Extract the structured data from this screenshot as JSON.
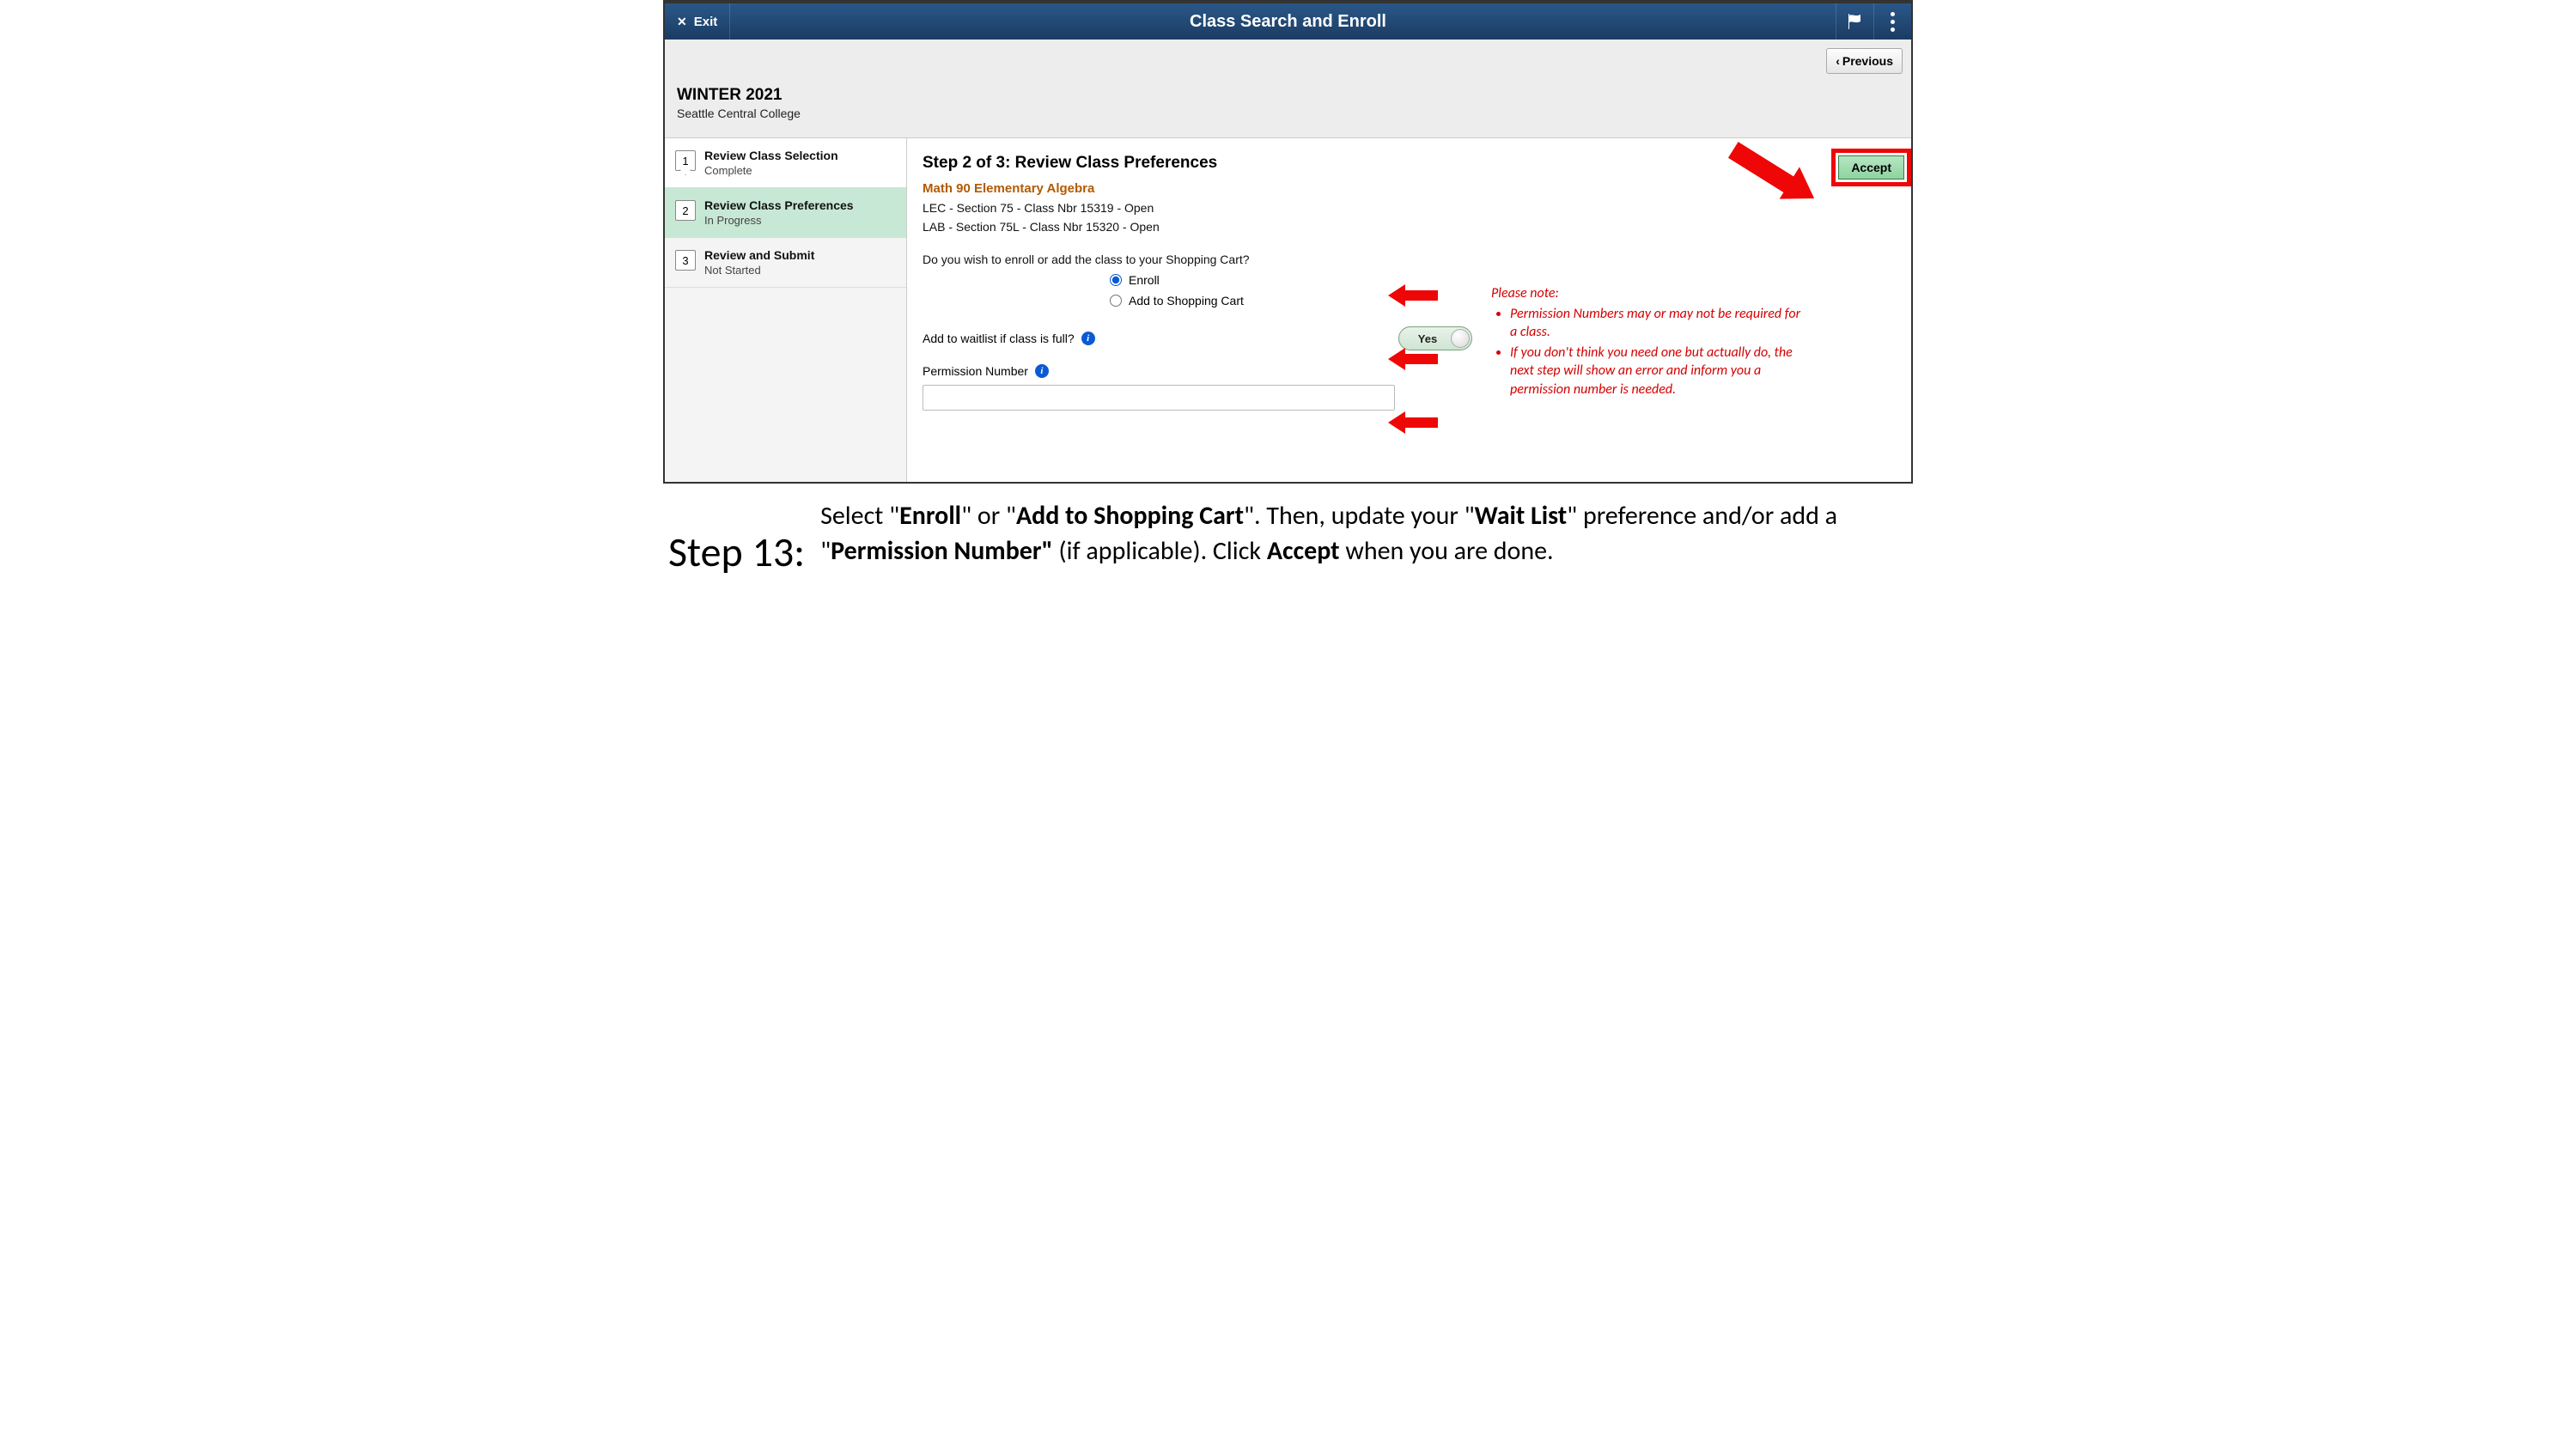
{
  "banner": {
    "exit_label": "Exit",
    "title": "Class Search and Enroll"
  },
  "nav": {
    "previous_label": "Previous"
  },
  "term": {
    "name": "WINTER 2021",
    "institution": "Seattle Central College"
  },
  "steps": [
    {
      "num": "1",
      "title": "Review Class Selection",
      "status": "Complete"
    },
    {
      "num": "2",
      "title": "Review Class Preferences",
      "status": "In Progress"
    },
    {
      "num": "3",
      "title": "Review and Submit",
      "status": "Not Started"
    }
  ],
  "main": {
    "heading": "Step 2 of 3: Review Class Preferences",
    "course": "Math 90  Elementary Algebra",
    "sections": [
      "LEC - Section 75 - Class Nbr 15319 - Open",
      "LAB - Section 75L - Class Nbr 15320 - Open"
    ],
    "question": "Do you wish to enroll or add the class to your Shopping Cart?",
    "radio_enroll": "Enroll",
    "radio_cart": "Add to Shopping Cart",
    "waitlist_label": "Add to waitlist if class is full?",
    "toggle_value": "Yes",
    "perm_label": "Permission Number",
    "perm_value": "",
    "accept_label": "Accept"
  },
  "note": {
    "heading": "Please note:",
    "bullets": [
      "Permission Numbers may or may not be required for a class.",
      "If you don't think you need one but actually do, the next step will show an error and inform you a permission number is needed."
    ]
  },
  "caption": {
    "label": "Step 13:",
    "seg1": "Select \"",
    "b1": "Enroll",
    "seg2": "\" or \"",
    "b2": "Add to Shopping Cart",
    "seg3": "\". Then, update your \"",
    "b3": "Wait List",
    "seg4": "\" preference and/or add a \"",
    "b4": "Permission Number\"",
    "seg5": " (if applicable). Click ",
    "b5": "Accept",
    "seg6": " when you are done."
  }
}
